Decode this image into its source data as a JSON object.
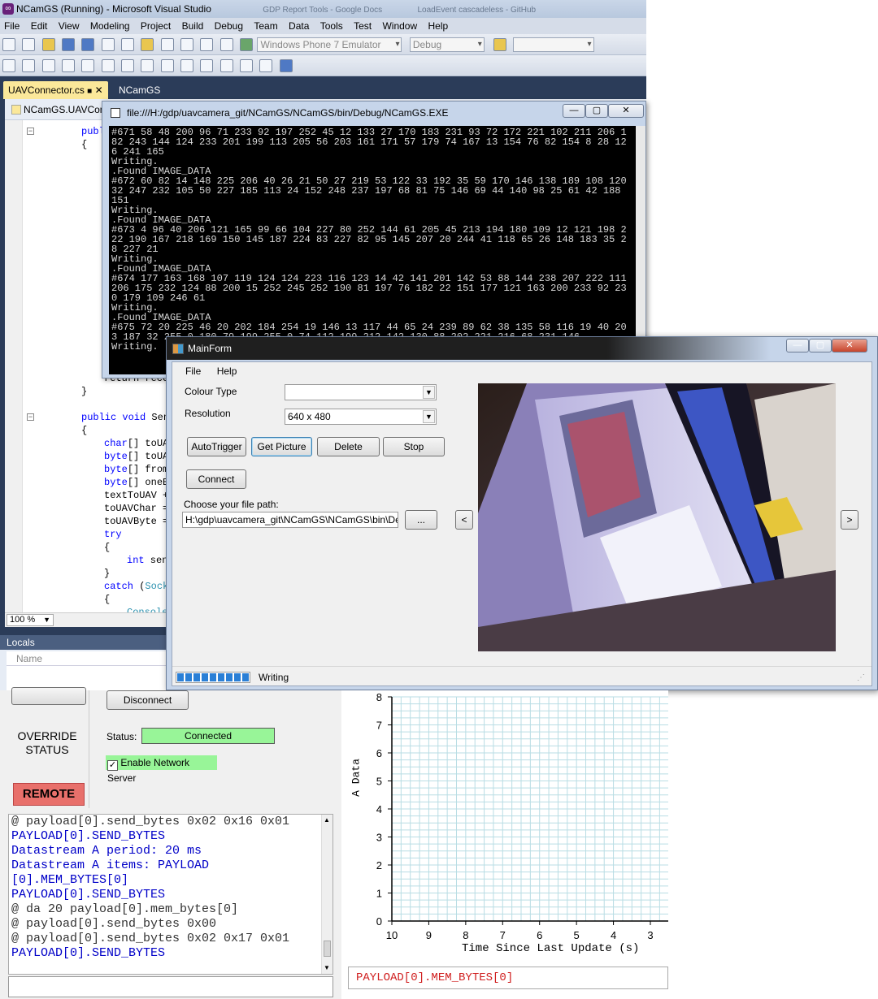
{
  "vs": {
    "title": "NCamGS (Running) - Microsoft Visual Studio",
    "ghost_tabs": [
      "GDP Report Tools - Google Docs",
      "LoadEvent cascadeless - GitHub"
    ],
    "menu": [
      "File",
      "Edit",
      "View",
      "Modeling",
      "Project",
      "Build",
      "Debug",
      "Team",
      "Data",
      "Tools",
      "Test",
      "Window",
      "Help"
    ],
    "target_combo": "Windows Phone 7 Emulator",
    "config_combo": "Debug",
    "tabs": [
      "UAVConnector.cs",
      "NCamGS"
    ],
    "breadcrumb": "NCamGS.UAVConnector",
    "code": {
      "l1_kw": "publ",
      "l2": "{",
      "l3": "return recei",
      "l4": "}",
      "l5_kw": "public void",
      "l5_rest": " Sen",
      "l6": "{",
      "l7_kw": "char",
      "l7": "[] toUA",
      "l8_kw": "byte",
      "l8": "[] toUA",
      "l9_kw": "byte",
      "l9": "[] from",
      "l10_kw": "byte",
      "l10": "[] oneB",
      "l11": "textToUAV +",
      "l12": "toUAVChar =",
      "l13": "toUAVByte =",
      "l14_kw": "try",
      "l15": "{",
      "l16_kw": "int",
      "l16": " sen",
      "l17": "}",
      "l18_kw": "catch",
      "l18": " (",
      "l18_ty": "Sock",
      "l19": "{",
      "l20": "Console"
    },
    "zoom": "100 %",
    "locals_title": "Locals",
    "locals_col": "Name"
  },
  "console": {
    "title": "file:///H:/gdp/uavcamera_git/NCamGS/NCamGS/bin/Debug/NCamGS.EXE",
    "lines": [
      "#671 58 48 200 96 71 233 92 197 252 45 12 133 27 170 183 231 93 72 172 221 102 211 206 182 243 144 124 233 201 199 113 205 56 203 161 171 57 179 74 167 13 154 76 82 154 8 28 126 241 165",
      "Writing.",
      ".Found IMAGE_DATA",
      "#672 60 82 14 148 225 206 40 26 21 50 27 219 53 122 33 192 35 59 170 146 138 189 108 120 32 247 232 105 50 227 185 113 24 152 248 237 197 68 81 75 146 69 44 140 98 25 61 42 188 151",
      "Writing.",
      ".Found IMAGE_DATA",
      "#673 4 96 40 206 121 165 99 66 104 227 80 252 144 61 205 45 213 194 180 109 12 121 198 222 190 167 218 169 150 145 187 224 83 227 82 95 145 207 20 244 41 118 65 26 148 183 35 28 227 21",
      "Writing.",
      ".Found IMAGE_DATA",
      "#674 177 163 168 107 119 124 124 223 116 123 14 42 141 201 142 53 88 144 238 207 222 111 206 175 232 124 88 200 15 252 245 252 190 81 197 76 182 22 151 177 121 163 200 233 92 230 179 109 246 61",
      "Writing.",
      ".Found IMAGE_DATA",
      "#675 72 20 225 46 20 202 184 254 19 146 13 117 44 65 24 239 89 62 38 135 58 116 19 40 203 187 32 255 0 180 79 199 255 0 74 112 199 212 142 130 88 202 221 216 68 231 146",
      "Writing."
    ]
  },
  "mainform": {
    "title": "MainForm",
    "menu": [
      "File",
      "Help"
    ],
    "colour_type_label": "Colour Type",
    "colour_type_value": "",
    "resolution_label": "Resolution",
    "resolution_value": "640 x 480",
    "buttons": {
      "autotrigger": "AutoTrigger",
      "get_picture": "Get Picture",
      "delete": "Delete",
      "stop": "Stop",
      "connect": "Connect",
      "browse": "...",
      "prev": "<",
      "next": ">"
    },
    "file_path_label": "Choose your file path:",
    "file_path_value": "H:\\gdp\\uavcamera_git\\NCamGS\\NCamGS\\bin\\Debug",
    "status_text": "Writing",
    "progress": 0.85
  },
  "ground": {
    "disconnect": "Disconnect",
    "override": "OVERRIDE STATUS",
    "status_label": "Status:",
    "status_value": "Connected",
    "enable_server": "Enable Network Server",
    "enable_server_checked": true,
    "remote": "REMOTE",
    "log": [
      {
        "t": "cmd",
        "s": "@ payload[0].send_bytes 0x02 0x16 0x01"
      },
      {
        "t": "out",
        "s": "PAYLOAD[0].SEND_BYTES"
      },
      {
        "t": "out",
        "s": "Datastream A period: 20 ms"
      },
      {
        "t": "out",
        "s": "Datastream A items: PAYLOAD"
      },
      {
        "t": "out",
        "s": "[0].MEM_BYTES[0]"
      },
      {
        "t": "out",
        "s": "PAYLOAD[0].SEND_BYTES"
      },
      {
        "t": "cmd",
        "s": "@ da 20 payload[0].mem_bytes[0]"
      },
      {
        "t": "cmd",
        "s": "@ payload[0].send_bytes 0x00"
      },
      {
        "t": "cmd",
        "s": "@ payload[0].send_bytes 0x02 0x17 0x01"
      },
      {
        "t": "out",
        "s": "PAYLOAD[0].SEND_BYTES"
      }
    ]
  },
  "chart_data": {
    "type": "line",
    "title": "",
    "xlabel": "Time Since Last Update (s)",
    "ylabel": "A Data",
    "xlim": [
      10,
      3
    ],
    "ylim": [
      0,
      8
    ],
    "x_ticks": [
      "10",
      "9",
      "8",
      "7",
      "6",
      "5",
      "4",
      "3"
    ],
    "y_ticks": [
      "0",
      "1",
      "2",
      "3",
      "4",
      "5",
      "6",
      "7",
      "8"
    ],
    "grid": true,
    "series": []
  },
  "plot_output": "PAYLOAD[0].MEM_BYTES[0]"
}
